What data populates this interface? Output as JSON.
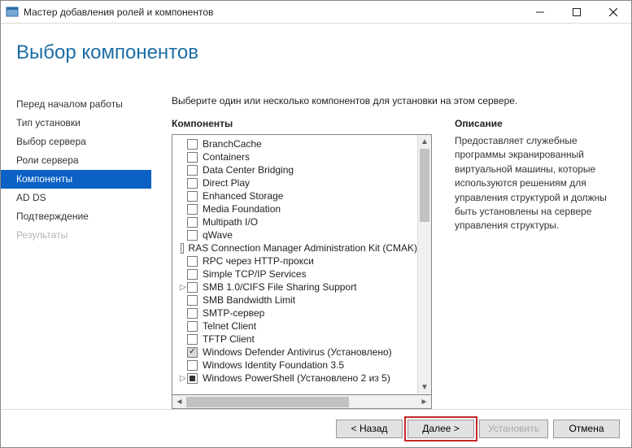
{
  "window": {
    "title": "Мастер добавления ролей и компонентов"
  },
  "page": {
    "title": "Выбор компонентов",
    "intro": "Выберите один или несколько компонентов для установки на этом сервере."
  },
  "sidebar": {
    "items": [
      {
        "label": "Перед началом работы",
        "state": "normal"
      },
      {
        "label": "Тип установки",
        "state": "normal"
      },
      {
        "label": "Выбор сервера",
        "state": "normal"
      },
      {
        "label": "Роли сервера",
        "state": "normal"
      },
      {
        "label": "Компоненты",
        "state": "active"
      },
      {
        "label": "AD DS",
        "state": "normal"
      },
      {
        "label": "Подтверждение",
        "state": "normal"
      },
      {
        "label": "Результаты",
        "state": "disabled"
      }
    ]
  },
  "columns": {
    "features_head": "Компоненты",
    "desc_head": "Описание",
    "description": "Предоставляет служебные программы экранированный виртуальной машины, которые используются решениям для управления структурой и должны быть установлены на сервере управления структуры."
  },
  "features": [
    {
      "label": "BranchCache",
      "checked": false,
      "expandable": false
    },
    {
      "label": "Containers",
      "checked": false,
      "expandable": false
    },
    {
      "label": "Data Center Bridging",
      "checked": false,
      "expandable": false
    },
    {
      "label": "Direct Play",
      "checked": false,
      "expandable": false
    },
    {
      "label": "Enhanced Storage",
      "checked": false,
      "expandable": false
    },
    {
      "label": "Media Foundation",
      "checked": false,
      "expandable": false
    },
    {
      "label": "Multipath I/O",
      "checked": false,
      "expandable": false
    },
    {
      "label": "qWave",
      "checked": false,
      "expandable": false
    },
    {
      "label": "RAS Connection Manager Administration Kit (CMAK)",
      "checked": false,
      "expandable": false
    },
    {
      "label": "RPC через HTTP-прокси",
      "checked": false,
      "expandable": false
    },
    {
      "label": "Simple TCP/IP Services",
      "checked": false,
      "expandable": false
    },
    {
      "label": "SMB 1.0/CIFS File Sharing Support",
      "checked": false,
      "expandable": true
    },
    {
      "label": "SMB Bandwidth Limit",
      "checked": false,
      "expandable": false
    },
    {
      "label": "SMTP-сервер",
      "checked": false,
      "expandable": false
    },
    {
      "label": "Telnet Client",
      "checked": false,
      "expandable": false
    },
    {
      "label": "TFTP Client",
      "checked": false,
      "expandable": false
    },
    {
      "label": "Windows Defender Antivirus (Установлено)",
      "checked": true,
      "expandable": false
    },
    {
      "label": "Windows Identity Foundation 3.5",
      "checked": false,
      "expandable": false
    },
    {
      "label": "Windows PowerShell (Установлено 2 из 5)",
      "checked": "partial",
      "expandable": true
    }
  ],
  "buttons": {
    "back": "< Назад",
    "next": "Далее >",
    "install": "Установить",
    "cancel": "Отмена"
  }
}
